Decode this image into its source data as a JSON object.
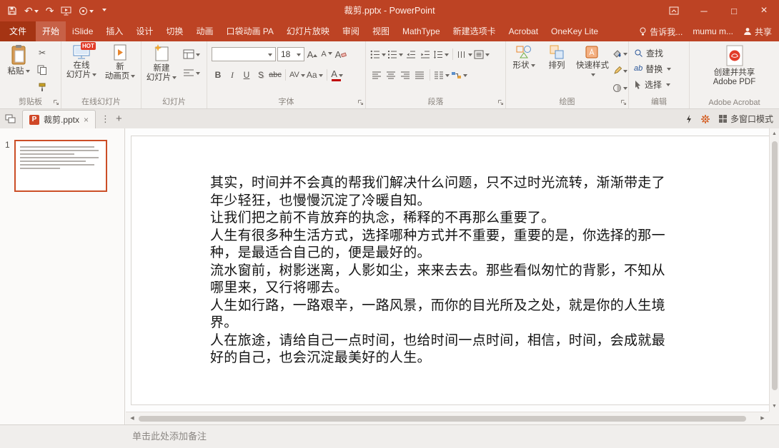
{
  "colors": {
    "accent": "#BD4324",
    "accent_dark": "#A53413",
    "ribbon_bg": "#F3F1EF",
    "badge": "#E23C28",
    "thumb_border": "#CB4E27",
    "fontcolor": "#C00000",
    "ppt_icon": "#D04727"
  },
  "icons": {
    "undo": "↶",
    "redo": "↷",
    "cut": "✂",
    "minimize": "─",
    "maximize": "□",
    "close": "×",
    "tab_close": "×",
    "tab_more": "⋮",
    "tab_add": "+",
    "up": "▲",
    "down": "▼",
    "left": "◀",
    "right": "▶",
    "replace_ab": "ab",
    "ppt": "P"
  },
  "titlebar": {
    "title": "裁剪.pptx - PowerPoint"
  },
  "tabs": [
    {
      "label": "文件"
    },
    {
      "label": "开始"
    },
    {
      "label": "iSlide"
    },
    {
      "label": "插入"
    },
    {
      "label": "设计"
    },
    {
      "label": "切换"
    },
    {
      "label": "动画"
    },
    {
      "label": "口袋动画 PA"
    },
    {
      "label": "幻灯片放映"
    },
    {
      "label": "审阅"
    },
    {
      "label": "视图"
    },
    {
      "label": "MathType"
    },
    {
      "label": "新建选项卡"
    },
    {
      "label": "Acrobat"
    },
    {
      "label": "OneKey Lite"
    }
  ],
  "tabs_right": {
    "tellme": "告诉我...",
    "user": "mumu m...",
    "share": "共享"
  },
  "ribbon": {
    "clipboard": {
      "paste": "粘贴",
      "label": "剪贴板"
    },
    "online": {
      "btn1_line1": "在线",
      "btn1_line2": "幻灯片",
      "badge": "HOT",
      "btn2_line1": "新",
      "btn2_line2": "动画页",
      "label": "在线幻灯片"
    },
    "slides": {
      "new_line1": "新建",
      "new_line2": "幻灯片",
      "label": "幻灯片"
    },
    "font": {
      "name": "",
      "size": "18",
      "grow": "A",
      "shrink": "A",
      "clear": "A",
      "bold": "B",
      "italic": "I",
      "underline": "U",
      "shadow": "S",
      "strike": "abc",
      "spacing": "AV",
      "case_btn": "Aa",
      "color": "A",
      "label": "字体"
    },
    "paragraph": {
      "label": "段落"
    },
    "drawing": {
      "shapes": "形状",
      "arrange": "排列",
      "styles": "快速样式",
      "label": "绘图"
    },
    "editing": {
      "find": "查找",
      "replace": "替换",
      "select": "选择",
      "label": "编辑"
    },
    "acrobat": {
      "line1": "创建并共享",
      "line2": "Adobe PDF",
      "label": "Adobe Acrobat"
    }
  },
  "doctab": {
    "tab": "裁剪.pptx",
    "multiwindow": "多窗口模式"
  },
  "thumbnails": {
    "number": "1"
  },
  "slide": {
    "lines": [
      "其实，时间并不会真的帮我们解决什么问题，只不过时光流转，渐渐带走了",
      "年少轻狂，也慢慢沉淀了冷暖自知。",
      "让我们把之前不肯放弃的执念，稀释的不再那么重要了。",
      "人生有很多种生活方式，选择哪种方式并不重要，重要的是，你选择的那一",
      "种，是最适合自己的，便是最好的。",
      "流水窗前，树影迷离，人影如尘，来来去去。那些看似匆忙的背影，不知从",
      "哪里来，又行将哪去。",
      "人生如行路，一路艰辛，一路风景，而你的目光所及之处，就是你的人生境",
      "界。",
      "人在旅途，请给自己一点时间，也给时间一点时间，相信，时间，会成就最",
      "好的自己，也会沉淀最美好的人生。"
    ]
  },
  "notes": {
    "placeholder": "单击此处添加备注"
  }
}
